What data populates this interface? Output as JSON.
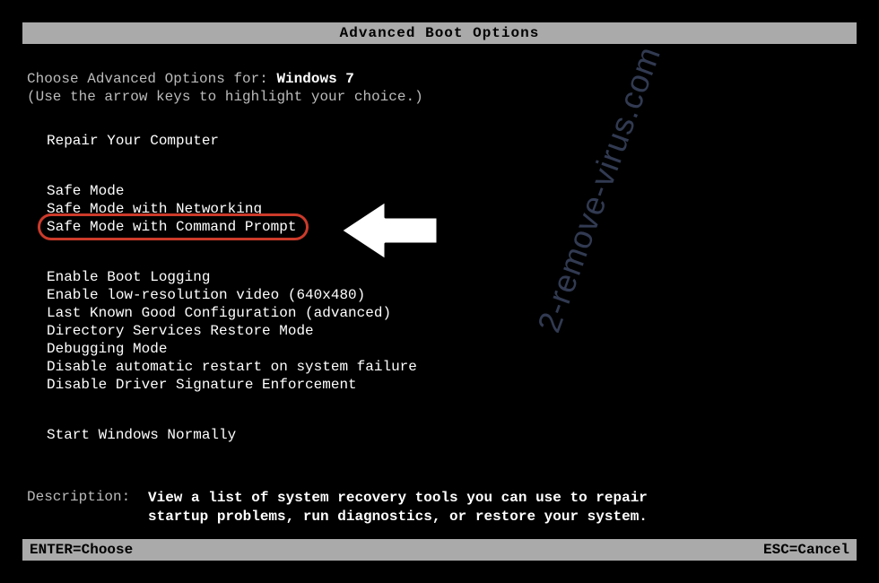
{
  "title": "Advanced Boot Options",
  "prompt": {
    "prefix": "Choose Advanced Options for: ",
    "os": "Windows 7",
    "hint": "(Use the arrow keys to highlight your choice.)"
  },
  "options": {
    "repair": "Repair Your Computer",
    "safe_mode": "Safe Mode",
    "safe_mode_networking": "Safe Mode with Networking",
    "safe_mode_cmd": "Safe Mode with Command Prompt",
    "boot_logging": "Enable Boot Logging",
    "low_res": "Enable low-resolution video (640x480)",
    "lkgc": "Last Known Good Configuration (advanced)",
    "ds_restore": "Directory Services Restore Mode",
    "debugging": "Debugging Mode",
    "disable_auto_restart": "Disable automatic restart on system failure",
    "disable_driver_sig": "Disable Driver Signature Enforcement",
    "start_normal": "Start Windows Normally"
  },
  "description": {
    "label": "Description:",
    "text_line1": "View a list of system recovery tools you can use to repair",
    "text_line2": "startup problems, run diagnostics, or restore your system."
  },
  "footer": {
    "enter": "ENTER=Choose",
    "esc": "ESC=Cancel"
  },
  "watermark": "2-remove-virus.com",
  "highlight_color": "#cc3a2a"
}
